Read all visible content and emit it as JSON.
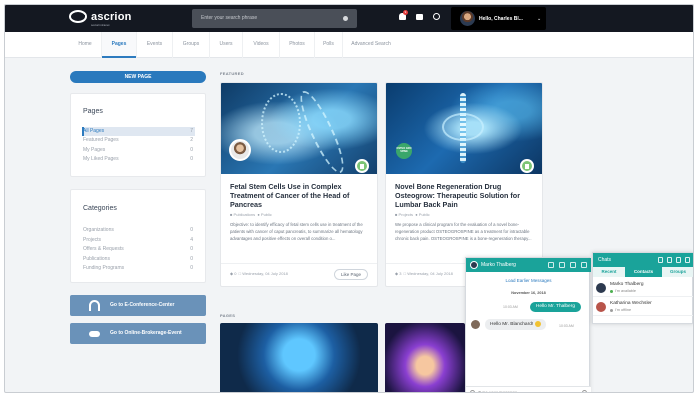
{
  "header": {
    "logo_text": "ascrion",
    "logo_sub": "social intranet",
    "search_placeholder": "Enter your search phrase",
    "notifications_count": "9",
    "user_greeting": "Hello, Charles Bl...",
    "caret": "⌄"
  },
  "nav": {
    "items": [
      {
        "label": "Home"
      },
      {
        "label": "Pages"
      },
      {
        "label": "Events"
      },
      {
        "label": "Groups"
      },
      {
        "label": "Users"
      },
      {
        "label": "Videos"
      },
      {
        "label": "Photos"
      },
      {
        "label": "Polls"
      },
      {
        "label": "Advanced Search"
      }
    ],
    "active": "Pages"
  },
  "sidebar": {
    "new_page_label": "NEW PAGE",
    "pages_panel": {
      "title": "Pages",
      "items": [
        {
          "label": "All Pages",
          "count": "7"
        },
        {
          "label": "Featured Pages",
          "count": "2"
        },
        {
          "label": "My Pages",
          "count": "0"
        },
        {
          "label": "My Liked Pages",
          "count": "0"
        }
      ]
    },
    "categories_panel": {
      "title": "Categories",
      "items": [
        {
          "label": "Organizations",
          "count": "0"
        },
        {
          "label": "Projects",
          "count": "4"
        },
        {
          "label": "Offers & Requests",
          "count": "0"
        },
        {
          "label": "Publications",
          "count": "0"
        },
        {
          "label": "Funding Programs",
          "count": "0"
        }
      ]
    },
    "conference_button": "Go to E-Conference-Center",
    "brokerage_button": "Go to Online-Brokerage-Event"
  },
  "main": {
    "featured_label": "FEATURED",
    "pages_label": "PAGES",
    "cards": [
      {
        "title": "Fetal Stem Cells Use in Complex Treatment of Cancer of the Head of Pancreas",
        "category": "Publications",
        "visibility": "Public",
        "description": "Objective: to identify efficacy of fetal stem cells use in treatment of the patients with cancer of caput pancreatis, to summarize all hematology advantages and positive effects on overall condition o...",
        "likes": "0",
        "date": "Wednesday, 04 July 2018",
        "like_button": "Like Page"
      },
      {
        "title": "Novel Bone Regeneration Drug Osteogrow: Therapeutic Solution for Lumbar Back Pain",
        "category": "Projects",
        "visibility": "Public",
        "badge": "OSTEO GRO SPINE",
        "description": "We propose a clinical program for the evaluation of a novel bone-regeneration product OSTEOGROSPINE as a treatment for intractable chronic back pain. OSTEOGROSPINE is a bone-regeneration therapy...",
        "likes": "3",
        "date": "Wednesday, 04 July 2018"
      }
    ]
  },
  "chat": {
    "contact_name": "Marko Thalberg",
    "load_earlier": "Load Earlier Messages",
    "date": "November 16, 2018",
    "outgoing_message": "Hello Mr. Thalberg",
    "outgoing_time": "10:03 AM",
    "incoming_message": "Hello Mr. Blanchard!",
    "incoming_time": "10:03 AM",
    "input_placeholder": "Type your message"
  },
  "chats_panel": {
    "title": "Chats",
    "tabs": [
      "Recent",
      "Contacts",
      "Groups"
    ],
    "active_tab": "Contacts",
    "contacts": [
      {
        "name": "Marko Thalberg",
        "status": "I'm available",
        "status_color": "#4caf50"
      },
      {
        "name": "Katharina Wechsler",
        "status": "I'm offline",
        "status_color": "#9e9e9e"
      }
    ]
  },
  "colors": {
    "brand_dark": "#141821",
    "accent_blue": "#2a79bd",
    "chat_teal": "#1aa39a",
    "button_steel": "#6a92b9"
  }
}
